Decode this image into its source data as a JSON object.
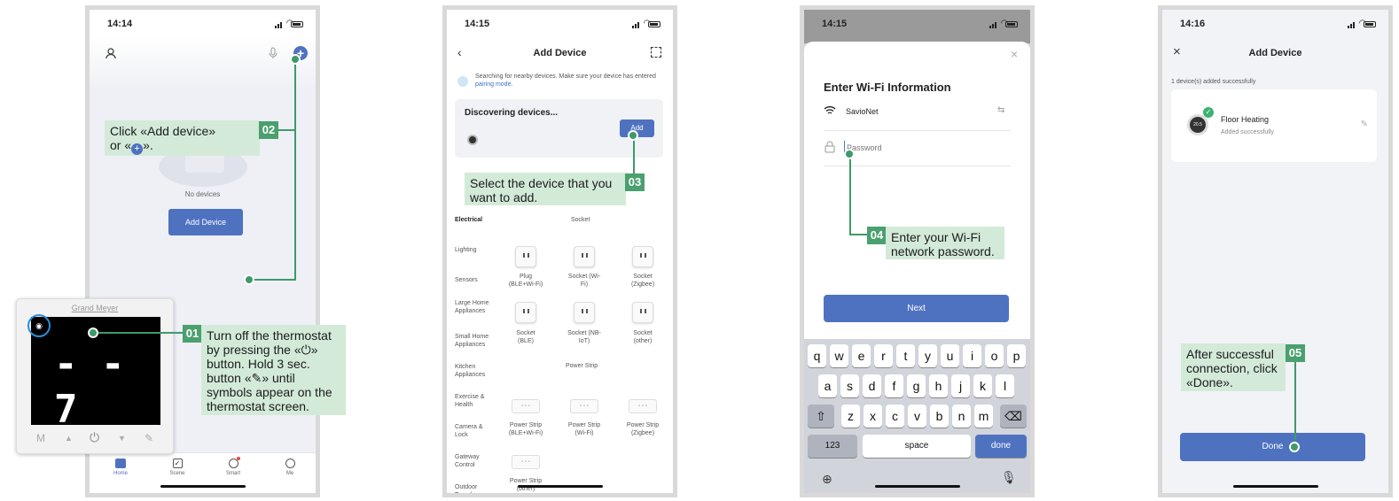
{
  "p1": {
    "time": "14:14",
    "no_devices": "No devices",
    "add_device_btn": "Add Device",
    "tabs": [
      "Home",
      "Scene",
      "Smart",
      "Me"
    ],
    "thermo": {
      "brand": "Grand Meyer",
      "digits": "- - 7",
      "controls": [
        "M",
        "▲",
        "⏻",
        "▼",
        "✎"
      ]
    }
  },
  "p1c": {
    "step1_badge": "01",
    "step1_text": "Turn off the thermostat by pressing the «⏻» button. Hold 3 sec. button «✎» until symbols appear on the thermostat screen.",
    "step2_badge": "02",
    "step2_line1": "Click «Add device»",
    "step2_line2a": "or «",
    "step2_line2b": "»."
  },
  "p2": {
    "time": "14:15",
    "title": "Add Device",
    "searching": "Searching for nearby devices. Make sure your device has entered",
    "pairing": "pairing mode",
    "period": ".",
    "discovering": "Discovering devices...",
    "add_btn": "Add",
    "categories": [
      "Electrical",
      "Lighting",
      "Sensors",
      "Large Home Appliances",
      "Small Home Appliances",
      "Kitchen Appliances",
      "Exercise & Health",
      "Camera & Lock",
      "Gateway Control",
      "Outdoor Travel"
    ],
    "socket_header": "Socket",
    "strip_header": "Power Strip",
    "devices_row1": [
      "Plug (BLE+Wi-Fi)",
      "Socket (Wi-Fi)",
      "Socket (Zigbee)"
    ],
    "devices_row2": [
      "Socket (BLE)",
      "Socket (NB-IoT)",
      "Socket (other)"
    ],
    "strips_row1": [
      "Power Strip (BLE+Wi-Fi)",
      "Power Strip (Wi-Fi)",
      "Power Strip (Zigbee)"
    ],
    "strips_row2": [
      "Power Strip (other)"
    ],
    "step3_badge": "03",
    "step3_text": "Select the device that you want to add."
  },
  "p3": {
    "time": "14:15",
    "title": "Enter Wi-Fi Information",
    "ssid": "SavioNet",
    "password_placeholder": "Password",
    "next_btn": "Next",
    "row1": [
      "q",
      "w",
      "e",
      "r",
      "t",
      "y",
      "u",
      "i",
      "o",
      "p"
    ],
    "row2": [
      "a",
      "s",
      "d",
      "f",
      "g",
      "h",
      "j",
      "k",
      "l"
    ],
    "row3": [
      "z",
      "x",
      "c",
      "v",
      "b",
      "n",
      "m"
    ],
    "num_key": "123",
    "space_key": "space",
    "done_key": "done",
    "step4_badge": "04",
    "step4_text": "Enter your Wi-Fi network password."
  },
  "p4": {
    "time": "14:16",
    "title": "Add Device",
    "added_count": "1 device(s) added successfully",
    "device_name": "Floor Heating",
    "device_status": "Added successfully",
    "device_temp": "20.5",
    "done_btn": "Done",
    "step5_badge": "05",
    "step5_text": "After successful connection, click «Done»."
  },
  "colors": {
    "accent": "#4f72c0",
    "callout_bg": "#d3ead9",
    "guide": "#3f9a69"
  }
}
